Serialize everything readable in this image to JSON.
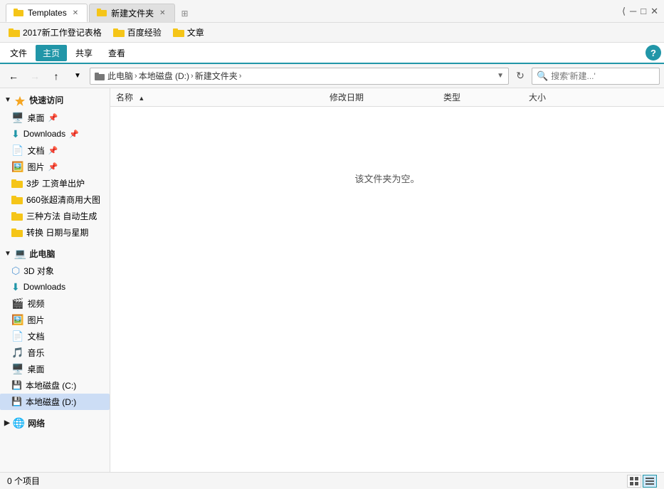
{
  "tabs": [
    {
      "id": "tab1",
      "label": "Templates",
      "active": true,
      "icon": "folder"
    },
    {
      "id": "tab2",
      "label": "新建文件夹",
      "active": false,
      "icon": "folder"
    }
  ],
  "quickbar": [
    {
      "label": "2017新工作登记表格",
      "icon": "folder-yellow"
    },
    {
      "label": "百度经验",
      "icon": "folder-yellow"
    },
    {
      "label": "文章",
      "icon": "folder-yellow"
    }
  ],
  "ribbon": {
    "buttons": [
      "文件",
      "主页",
      "共享",
      "查看"
    ]
  },
  "address": {
    "crumbs": [
      "此电脑",
      "本地磁盘 (D:)",
      "新建文件夹"
    ],
    "search_placeholder": "搜索'新建...'",
    "refresh_icon": "refresh"
  },
  "sidebar": {
    "quick_access_label": "快速访问",
    "items_quick": [
      {
        "label": "桌面",
        "icon": "desktop",
        "pinned": true
      },
      {
        "label": "Downloads",
        "icon": "downloads",
        "pinned": true
      },
      {
        "label": "文档",
        "icon": "docs",
        "pinned": true
      },
      {
        "label": "图片",
        "icon": "pics",
        "pinned": true
      },
      {
        "label": "3步 工资单出炉",
        "icon": "folder-yellow",
        "pinned": false
      },
      {
        "label": "660张超清商用大图",
        "icon": "folder-yellow",
        "pinned": false
      },
      {
        "label": "三种方法 自动生成",
        "icon": "folder-yellow",
        "pinned": false
      },
      {
        "label": "转换 日期与星期",
        "icon": "folder-yellow",
        "pinned": false
      }
    ],
    "this_pc_label": "此电脑",
    "items_pc": [
      {
        "label": "3D 对象",
        "icon": "3d"
      },
      {
        "label": "Downloads",
        "icon": "downloads"
      },
      {
        "label": "视频",
        "icon": "video"
      },
      {
        "label": "图片",
        "icon": "pics"
      },
      {
        "label": "文档",
        "icon": "docs"
      },
      {
        "label": "音乐",
        "icon": "music"
      },
      {
        "label": "桌面",
        "icon": "desktop"
      },
      {
        "label": "本地磁盘 (C:)",
        "icon": "disk"
      },
      {
        "label": "本地磁盘 (D:)",
        "icon": "disk",
        "active": true
      }
    ],
    "network_label": "网络",
    "network_icon": "network"
  },
  "content": {
    "columns": [
      "名称",
      "修改日期",
      "类型",
      "大小"
    ],
    "empty_message": "该文件夹为空。",
    "rows": []
  },
  "statusbar": {
    "count_label": "0 个项目",
    "view_icons": [
      "grid",
      "list"
    ]
  }
}
